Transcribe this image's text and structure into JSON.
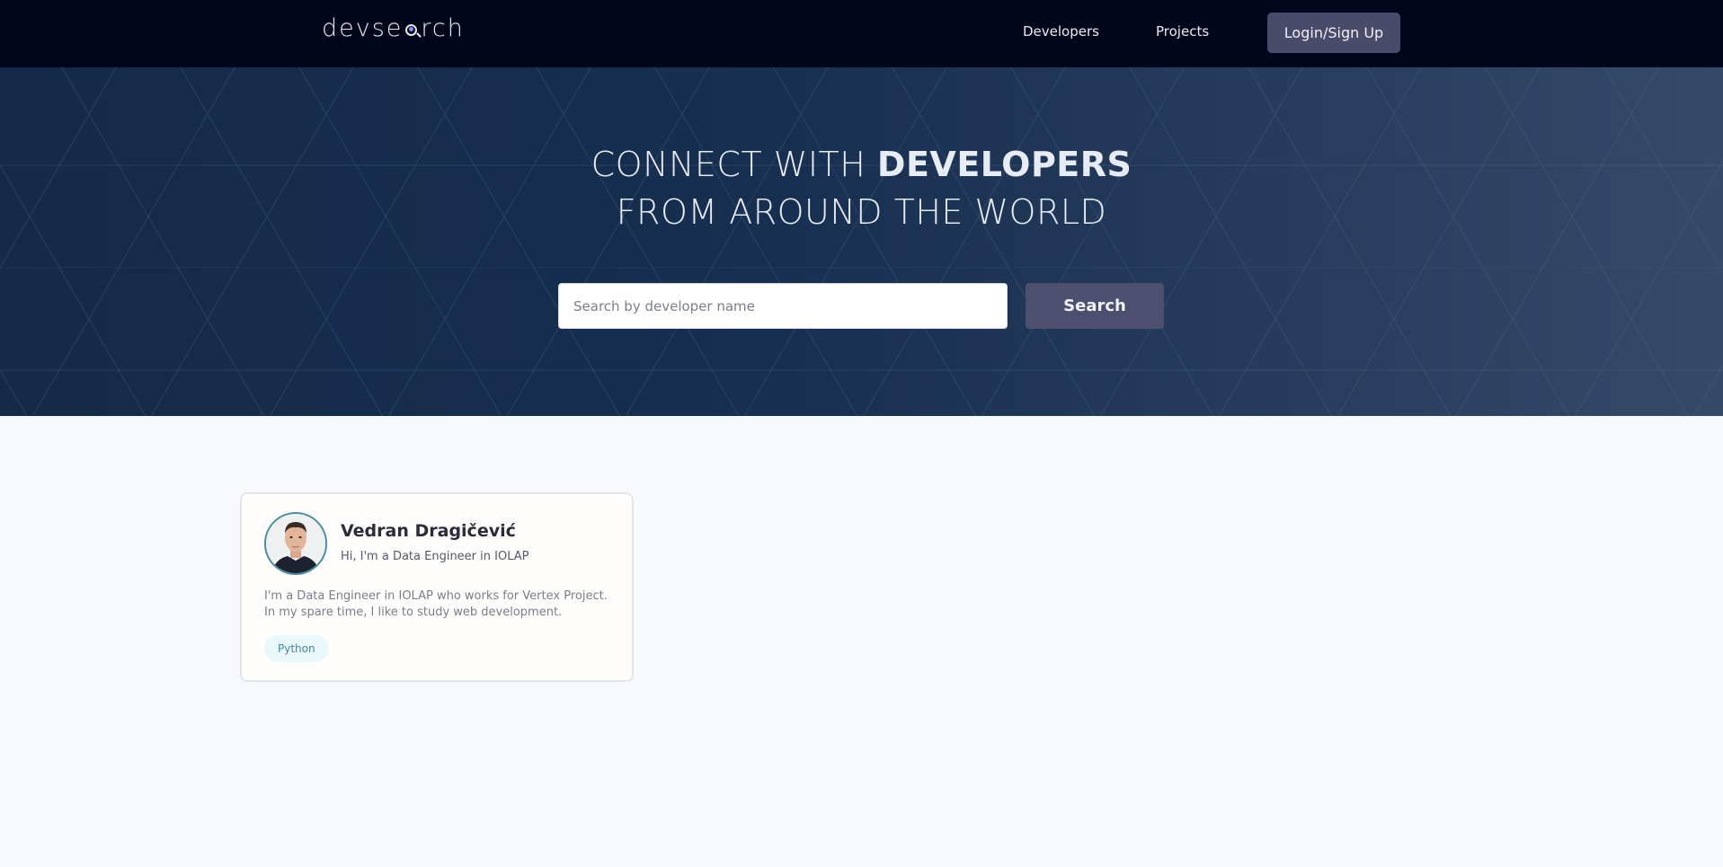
{
  "header": {
    "logo_prefix": "devse",
    "logo_suffix": "rch",
    "nav": {
      "developers": "Developers",
      "projects": "Projects",
      "login": "Login/Sign Up"
    }
  },
  "hero": {
    "title_line1_light": "CONNECT WITH ",
    "title_line1_bold": "DEVELOPERS",
    "title_line2": "FROM AROUND THE WORLD",
    "search_placeholder": "Search by developer name",
    "search_button": "Search"
  },
  "developers": [
    {
      "name": "Vedran Dragičević",
      "headline": "Hi, I'm a Data Engineer in IOLAP",
      "bio": "I'm a Data Engineer in IOLAP who works for Vertex Project. In my spare time, I like to study web development.",
      "skills": [
        "Python"
      ]
    }
  ],
  "colors": {
    "header_bg": "#03061a",
    "accent_button": "#4a4b6a",
    "skill_tag_bg": "#e8f8fb",
    "skill_tag_text": "#3f8a9a",
    "page_bg": "#f8f9fd"
  }
}
